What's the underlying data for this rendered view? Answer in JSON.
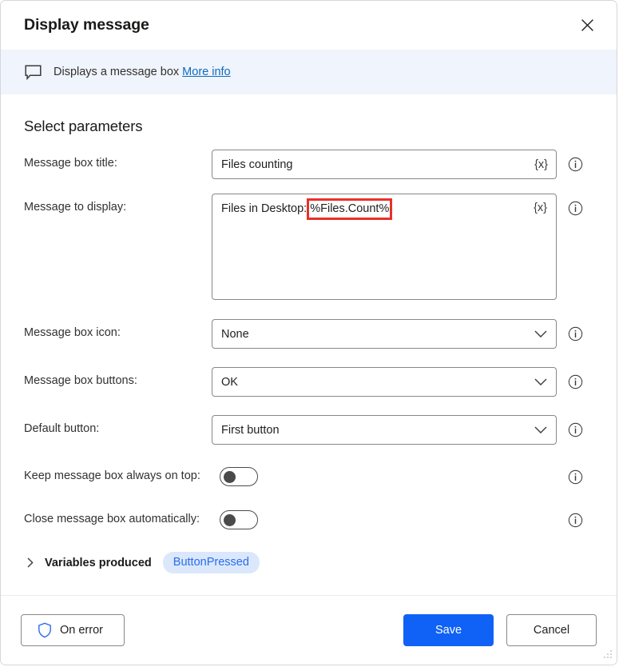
{
  "dialog": {
    "title": "Display message",
    "close_icon": "close-icon"
  },
  "banner": {
    "icon": "message-box-icon",
    "text": "Displays a message box",
    "link": "More info"
  },
  "section": {
    "title": "Select parameters"
  },
  "fields": {
    "message_box_title": {
      "label": "Message box title:",
      "value": "Files counting",
      "variable_button": "{x}",
      "info_icon": "info-icon"
    },
    "message_to_display": {
      "label": "Message to display:",
      "value_prefix": "Files in Desktop: ",
      "value_highlight": "%Files.Count%",
      "variable_button": "{x}",
      "highlight_color": "#e8302a",
      "info_icon": "info-icon"
    },
    "message_box_icon": {
      "label": "Message box icon:",
      "value": "None",
      "info_icon": "info-icon"
    },
    "message_box_buttons": {
      "label": "Message box buttons:",
      "value": "OK",
      "info_icon": "info-icon"
    },
    "default_button": {
      "label": "Default button:",
      "value": "First button",
      "info_icon": "info-icon"
    },
    "keep_on_top": {
      "label": "Keep message box always on top:",
      "state": "off",
      "info_icon": "info-icon"
    },
    "close_automatically": {
      "label": "Close message box automatically:",
      "state": "off",
      "info_icon": "info-icon"
    }
  },
  "variables_produced": {
    "label": "Variables produced",
    "expanded": false,
    "chevron_icon": "chevron-right-icon",
    "items": [
      {
        "name": "ButtonPressed"
      }
    ]
  },
  "footer": {
    "on_error_label": "On error",
    "on_error_icon": "shield-icon",
    "save_label": "Save",
    "cancel_label": "Cancel",
    "resize_grip": "resize-grip-icon"
  },
  "colors": {
    "primary": "#0f62f5",
    "link": "#0f6cbd",
    "banner_bg": "#eff4fd",
    "pill_bg": "#dbe8fb",
    "pill_text": "#2a6ced",
    "highlight": "#e8302a",
    "border": "#8a8886"
  }
}
